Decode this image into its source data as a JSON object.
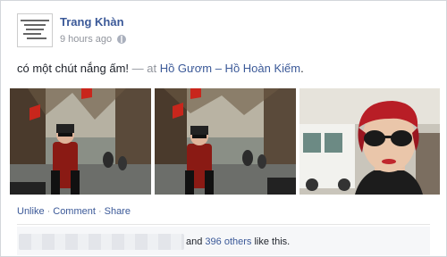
{
  "post": {
    "author": "Trang Khàn",
    "time": "9 hours ago",
    "status_text": "có một chút nắng ấm!",
    "at_prefix": " — at ",
    "place": "Hồ Gươm – Hồ Hoàn Kiếm",
    "place_suffix": "."
  },
  "actions": {
    "unlike": "Unlike",
    "comment": "Comment",
    "share": "Share",
    "separator": "·"
  },
  "likes": {
    "and": "and ",
    "others_count": "396 others",
    "suffix": " like this."
  },
  "colors": {
    "link": "#3b5998",
    "meta": "#90949c"
  }
}
